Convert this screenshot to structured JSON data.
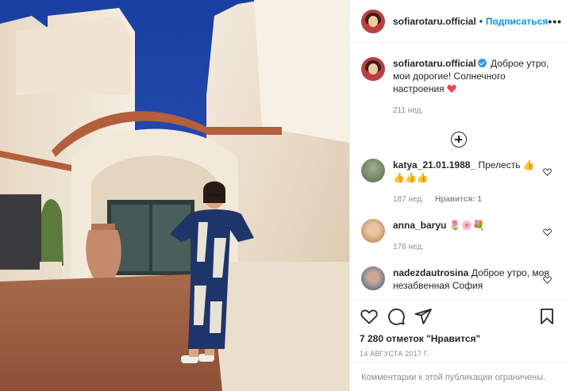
{
  "header": {
    "username": "sofiarotaru.official",
    "separator": "•",
    "follow_label": "Подписаться",
    "more_label": "•••",
    "avatar_icon": "profile-avatar"
  },
  "caption": {
    "username": "sofiarotaru.official",
    "text": "Доброе утро, мои дорогие! Солнечного настроения",
    "time": "211 нед."
  },
  "comments": [
    {
      "username": "katya_21.01.1988_",
      "text": "Прелесть",
      "time": "187 нед.",
      "likes": "Нравится: 1"
    },
    {
      "username": "anna_baryu",
      "text": "",
      "time": "176 нед."
    },
    {
      "username": "nadezdautrosina",
      "text": "Доброе утро, моя незабвенная София"
    }
  ],
  "actions": {
    "likes": "7 280 отметок \"Нравится\"",
    "date": "14 АВГУСТА 2017 Г."
  },
  "footer": {
    "text": "Комментарии к этой публикации ограничены."
  },
  "colors": {
    "accent": "#0095f6",
    "verified": "#3897f0",
    "muted": "#8e8e8e",
    "heart": "#ed4956"
  }
}
